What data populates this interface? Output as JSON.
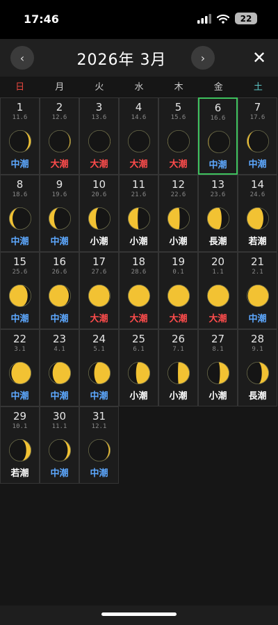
{
  "status_bar": {
    "time": "17:46",
    "battery": "22"
  },
  "header": {
    "prev": "‹",
    "title": "2026年 3月",
    "next": "›",
    "close": "✕"
  },
  "weekdays": [
    "日",
    "月",
    "火",
    "水",
    "木",
    "金",
    "土"
  ],
  "colors": {
    "sunday": "#e8473f",
    "saturday": "#5cc6c6",
    "today_border": "#3ec25e",
    "moon": "#f2c233",
    "tide_large": "#ff4c4c",
    "tide_medium": "#5da8ff",
    "tide_other": "#ffffff"
  },
  "tide_colors": {
    "大潮": "#ff4c4c",
    "中潮": "#5da8ff",
    "小潮": "#ffffff",
    "長潮": "#ffffff",
    "若潮": "#ffffff"
  },
  "first_weekday": 0,
  "today": 6,
  "days": [
    {
      "day": "1",
      "age": "11.6",
      "tide": "中潮",
      "phase": 11.6
    },
    {
      "day": "2",
      "age": "12.6",
      "tide": "大潮",
      "phase": 12.6
    },
    {
      "day": "3",
      "age": "13.6",
      "tide": "大潮",
      "phase": 13.6
    },
    {
      "day": "4",
      "age": "14.6",
      "tide": "大潮",
      "phase": 14.6
    },
    {
      "day": "5",
      "age": "15.6",
      "tide": "大潮",
      "phase": 15.6
    },
    {
      "day": "6",
      "age": "16.6",
      "tide": "中潮",
      "phase": 16.6
    },
    {
      "day": "7",
      "age": "17.6",
      "tide": "中潮",
      "phase": 17.6
    },
    {
      "day": "8",
      "age": "18.6",
      "tide": "中潮",
      "phase": 18.6
    },
    {
      "day": "9",
      "age": "19.6",
      "tide": "中潮",
      "phase": 19.6
    },
    {
      "day": "10",
      "age": "20.6",
      "tide": "小潮",
      "phase": 20.6
    },
    {
      "day": "11",
      "age": "21.6",
      "tide": "小潮",
      "phase": 21.6
    },
    {
      "day": "12",
      "age": "22.6",
      "tide": "小潮",
      "phase": 22.6
    },
    {
      "day": "13",
      "age": "23.6",
      "tide": "長潮",
      "phase": 23.6
    },
    {
      "day": "14",
      "age": "24.6",
      "tide": "若潮",
      "phase": 24.6
    },
    {
      "day": "15",
      "age": "25.6",
      "tide": "中潮",
      "phase": 25.6
    },
    {
      "day": "16",
      "age": "26.6",
      "tide": "中潮",
      "phase": 26.6
    },
    {
      "day": "17",
      "age": "27.6",
      "tide": "大潮",
      "phase": 27.6
    },
    {
      "day": "18",
      "age": "28.6",
      "tide": "大潮",
      "phase": 28.6
    },
    {
      "day": "19",
      "age": "0.1",
      "tide": "大潮",
      "phase": 0.1
    },
    {
      "day": "20",
      "age": "1.1",
      "tide": "大潮",
      "phase": 1.1
    },
    {
      "day": "21",
      "age": "2.1",
      "tide": "中潮",
      "phase": 2.1
    },
    {
      "day": "22",
      "age": "3.1",
      "tide": "中潮",
      "phase": 3.1
    },
    {
      "day": "23",
      "age": "4.1",
      "tide": "中潮",
      "phase": 4.1
    },
    {
      "day": "24",
      "age": "5.1",
      "tide": "中潮",
      "phase": 5.1
    },
    {
      "day": "25",
      "age": "6.1",
      "tide": "小潮",
      "phase": 6.1
    },
    {
      "day": "26",
      "age": "7.1",
      "tide": "小潮",
      "phase": 7.1
    },
    {
      "day": "27",
      "age": "8.1",
      "tide": "小潮",
      "phase": 8.1
    },
    {
      "day": "28",
      "age": "9.1",
      "tide": "長潮",
      "phase": 9.1
    },
    {
      "day": "29",
      "age": "10.1",
      "tide": "若潮",
      "phase": 10.1
    },
    {
      "day": "30",
      "age": "11.1",
      "tide": "中潮",
      "phase": 11.1
    },
    {
      "day": "31",
      "age": "12.1",
      "tide": "中潮",
      "phase": 12.1
    }
  ]
}
